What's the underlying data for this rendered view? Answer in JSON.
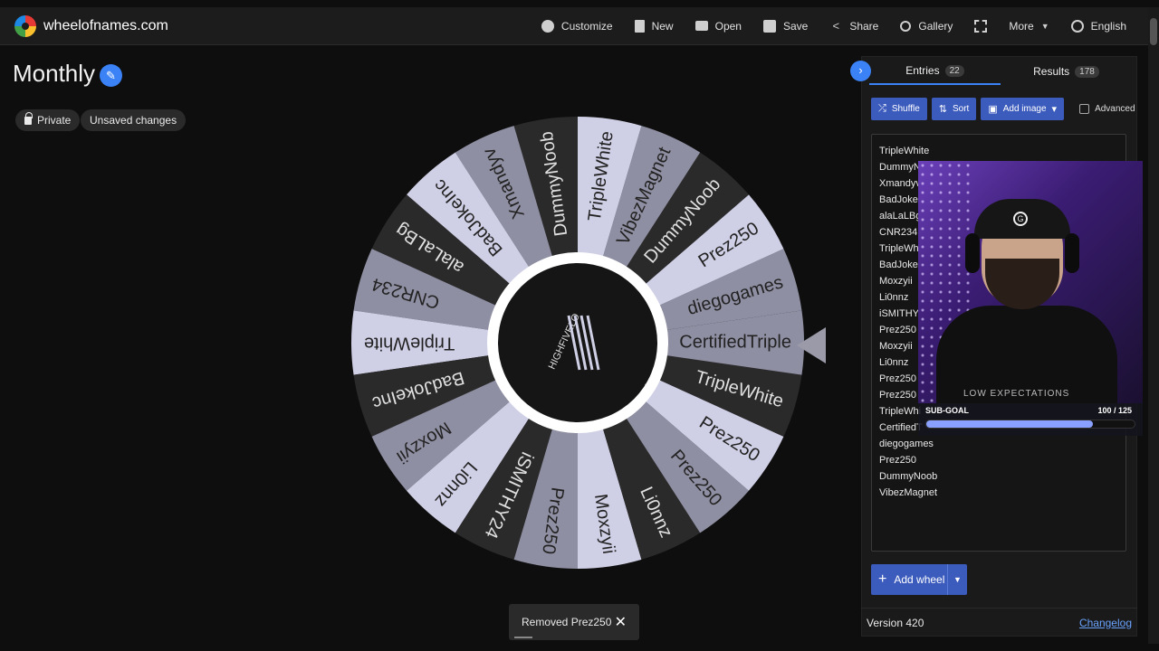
{
  "app": {
    "domain": "wheelofnames.com"
  },
  "nav": {
    "customize": "Customize",
    "new": "New",
    "open": "Open",
    "save": "Save",
    "share": "Share",
    "gallery": "Gallery",
    "more": "More",
    "language": "English"
  },
  "wheel": {
    "title": "Monthly",
    "privacy": "Private",
    "status": "Unsaved changes",
    "segments": [
      "diegogames",
      "Prez250",
      "DummyNoob",
      "VibezMagnet",
      "TripleWhite",
      "DummyNoob",
      "Xmandyv",
      "BadJokeInc",
      "alaLaLBg",
      "CNR234",
      "TripleWhite",
      "BadJokeInc",
      "Moxzyii",
      "Li0nnz",
      "iSMITHY24",
      "Prez250",
      "Moxzyii",
      "Li0nnz",
      "Prez250",
      "Prez250",
      "TripleWhite",
      "CertifiedTriple"
    ],
    "center_logo": "HIGHFIVELO",
    "colors": {
      "light": "#cfcfe6",
      "mid": "#8f8fa3",
      "dark": "#2a2a2a"
    }
  },
  "toast": {
    "text": "Removed Prez250",
    "close_icon": "close-icon"
  },
  "panel": {
    "tabs": [
      {
        "label": "Entries",
        "count": "22"
      },
      {
        "label": "Results",
        "count": "178"
      }
    ],
    "shuffle": "Shuffle",
    "sort": "Sort",
    "add_image": "Add image",
    "advanced": "Advanced",
    "entries": [
      "TripleWhite",
      "DummyN",
      "Xmandyv",
      "BadJokeIn",
      "alaLaLBg",
      "CNR234",
      "TripleWhi",
      "BadJokeIn",
      "Moxzyii",
      "Li0nnz",
      "iSMITHY2",
      "Prez250",
      "Moxzyii",
      "Li0nnz",
      "Prez250",
      "Prez250",
      "TripleWhi",
      "CertifiedT",
      "diegogames",
      "Prez250",
      "DummyNoob",
      "VibezMagnet"
    ],
    "add_wheel": "Add wheel",
    "version": "Version 420",
    "changelog": "Changelog"
  },
  "overlay": {
    "sub_goal_label": "SUB-GOAL",
    "sub_goal_count": "100 / 125",
    "sub_goal_progress": 0.8,
    "shirt_text": "LOW EXPECTATIONS"
  },
  "accent": "#3b82f6"
}
